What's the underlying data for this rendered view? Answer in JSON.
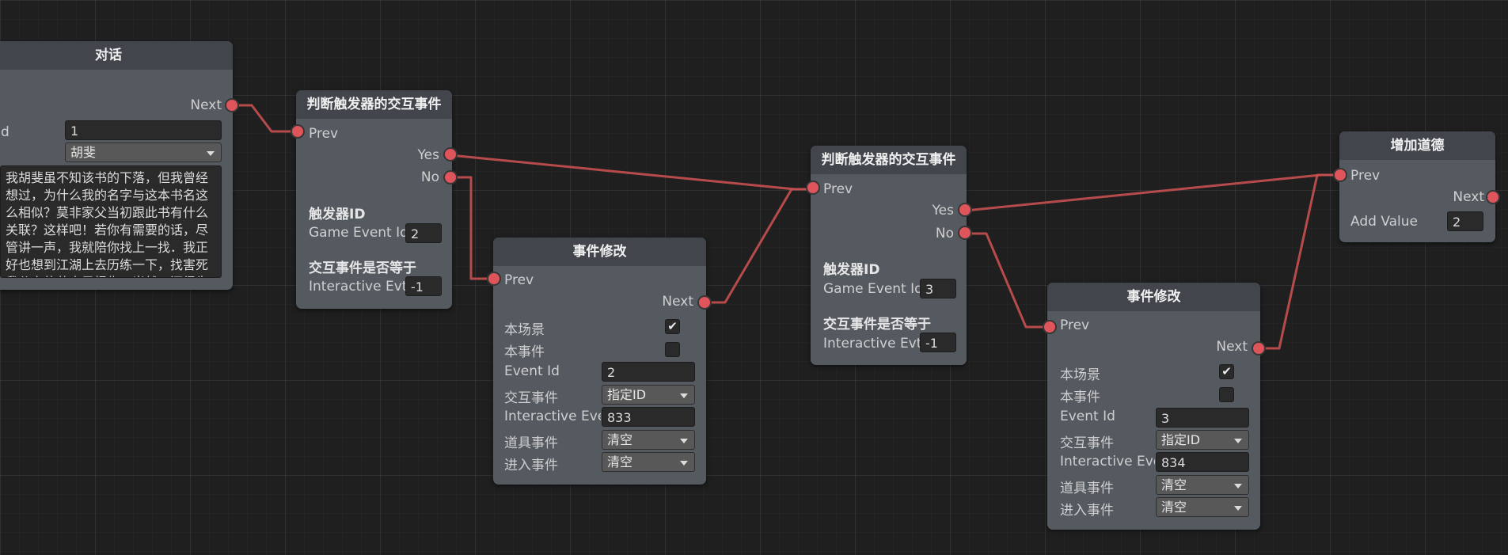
{
  "dialog_node": {
    "title": "对话",
    "next_label": "Next",
    "id_label": "Id",
    "id_value": "1",
    "speaker_value": "胡斐",
    "text": "我胡斐虽不知该书的下落，但我曾经想过，为什么我的名字与这本书名这么相似？莫非家父当初跟此书有什么关联？这样吧！若你有需要的话，尽管讲一声，我就陪你找上一找．我正好也想到江湖上去历练一下，找害死我父亲的苗人凤报仇。当然，还得先"
  },
  "judge_node_1": {
    "title": "判断触发器的交互事件",
    "prev_label": "Prev",
    "yes_label": "Yes",
    "no_label": "No",
    "trigger_heading": "触发器ID",
    "game_event_label": "Game Event Id",
    "game_event_value": "2",
    "interactive_heading": "交互事件是否等于",
    "interactive_label": "Interactive Evt",
    "interactive_value": "-1"
  },
  "event_node_1": {
    "title": "事件修改",
    "prev_label": "Prev",
    "next_label": "Next",
    "this_scene_label": "本场景",
    "this_scene_checked": true,
    "this_event_label": "本事件",
    "this_event_checked": false,
    "event_id_label": "Event Id",
    "event_id_value": "2",
    "interactive_event_label": "交互事件",
    "interactive_event_value": "指定ID",
    "interactive_eve_label": "Interactive Eve",
    "interactive_eve_value": "833",
    "item_event_label": "道具事件",
    "item_event_value": "清空",
    "enter_event_label": "进入事件",
    "enter_event_value": "清空"
  },
  "judge_node_2": {
    "title": "判断触发器的交互事件",
    "prev_label": "Prev",
    "yes_label": "Yes",
    "no_label": "No",
    "trigger_heading": "触发器ID",
    "game_event_label": "Game Event Id",
    "game_event_value": "3",
    "interactive_heading": "交互事件是否等于",
    "interactive_label": "Interactive Evt",
    "interactive_value": "-1"
  },
  "event_node_2": {
    "title": "事件修改",
    "prev_label": "Prev",
    "next_label": "Next",
    "this_scene_label": "本场景",
    "this_scene_checked": true,
    "this_event_label": "本事件",
    "this_event_checked": false,
    "event_id_label": "Event Id",
    "event_id_value": "3",
    "interactive_event_label": "交互事件",
    "interactive_event_value": "指定ID",
    "interactive_eve_label": "Interactive Eve",
    "interactive_eve_value": "834",
    "item_event_label": "道具事件",
    "item_event_value": "清空",
    "enter_event_label": "进入事件",
    "enter_event_value": "清空"
  },
  "morality_node": {
    "title": "增加道德",
    "prev_label": "Prev",
    "next_label": "Next",
    "add_value_label": "Add Value",
    "add_value_value": "2"
  },
  "colors": {
    "wire": "#c85050",
    "port": "#e0555b",
    "node_body": "#555a61",
    "node_header": "#42464c",
    "canvas": "#1f1f1f"
  }
}
